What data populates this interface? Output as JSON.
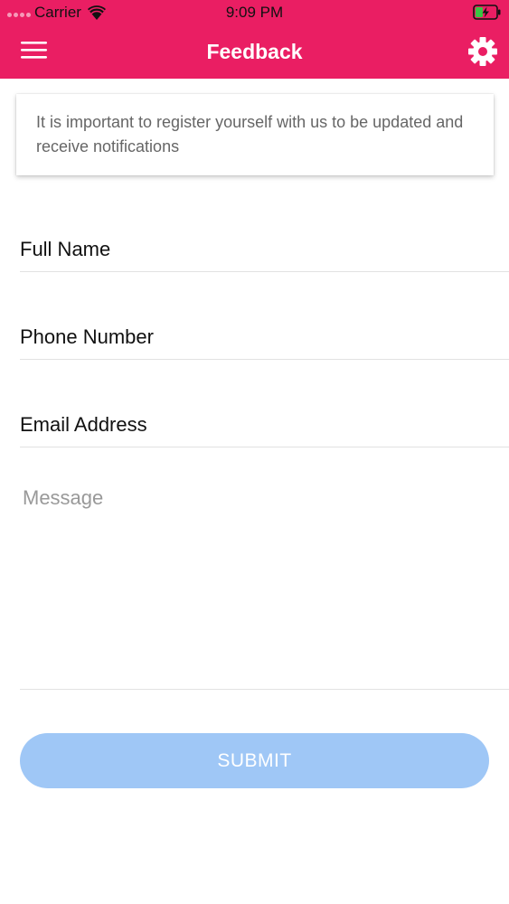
{
  "status_bar": {
    "carrier": "Carrier",
    "time": "9:09 PM",
    "icons": [
      "signal-dots-icon",
      "wifi-icon",
      "battery-charging-icon"
    ]
  },
  "header": {
    "title": "Feedback",
    "menu_icon": "hamburger-menu-icon",
    "settings_icon": "gear-icon",
    "background_color": "#ea1e63"
  },
  "notice": {
    "text": "It is important to register yourself with us to be updated and receive notifications"
  },
  "form": {
    "full_name": {
      "placeholder": "Full Name",
      "value": ""
    },
    "phone_number": {
      "placeholder": "Phone Number",
      "value": ""
    },
    "email_address": {
      "placeholder": "Email Address",
      "value": ""
    },
    "message": {
      "placeholder": "Message",
      "value": ""
    }
  },
  "submit": {
    "label": "SUBMIT",
    "color": "#9fc7f6"
  }
}
